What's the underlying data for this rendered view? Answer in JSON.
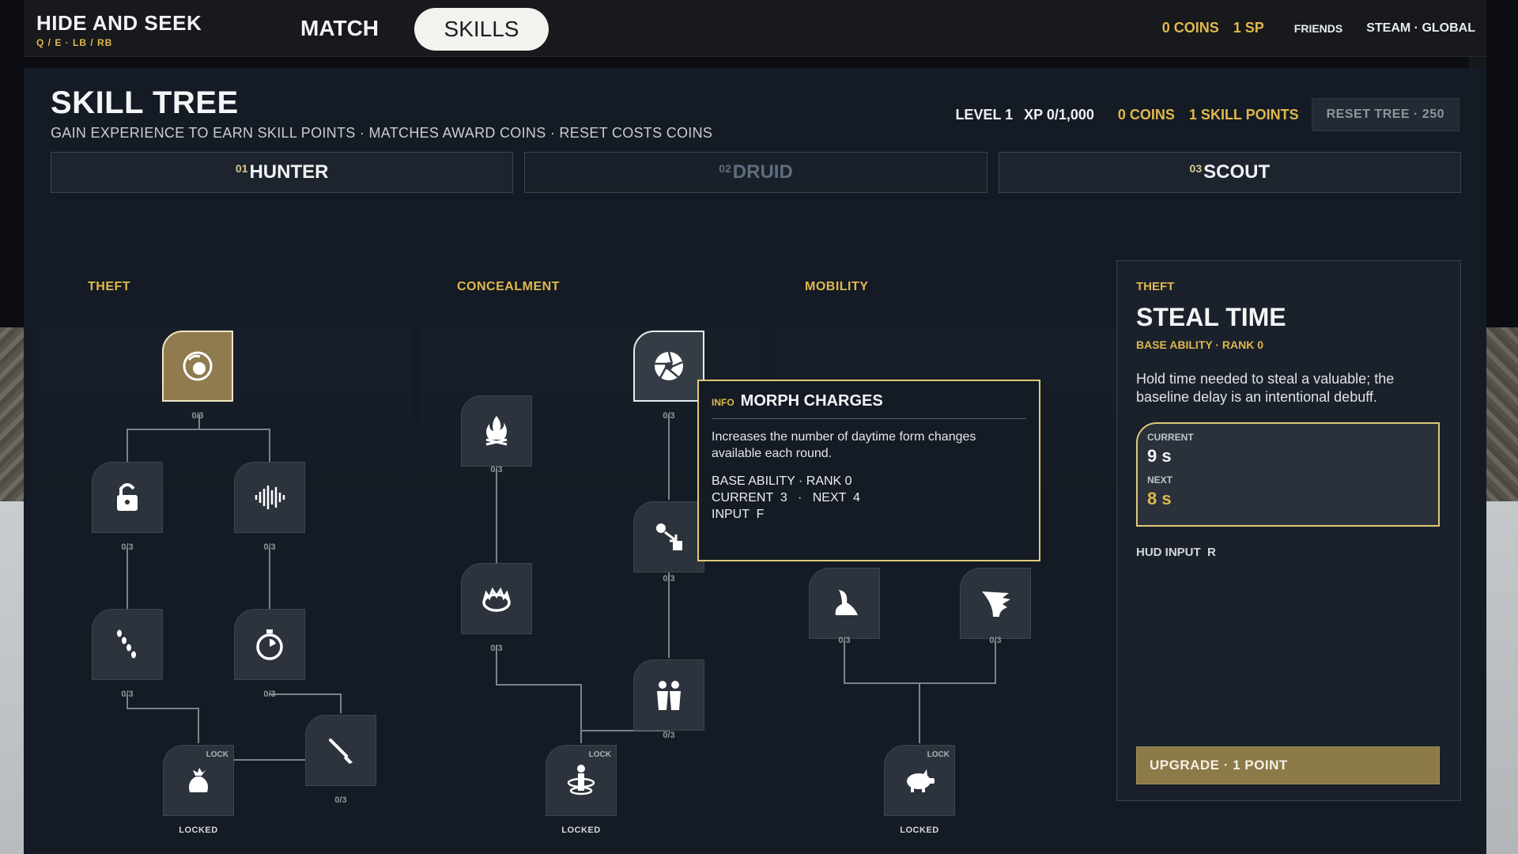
{
  "topbar": {
    "title": "HIDE AND SEEK",
    "subtitle": "Q / E · LB / RB",
    "nav_match": "MATCH",
    "nav_skills": "SKILLS",
    "coins": "0 COINS",
    "sp": "1 SP",
    "friends": "FRIENDS",
    "platform": "STEAM · GLOBAL"
  },
  "header": {
    "title": "SKILL TREE",
    "subtitle": "GAIN EXPERIENCE TO EARN SKILL POINTS · MATCHES AWARD COINS · RESET COSTS COINS",
    "level": "LEVEL 1",
    "xp": "XP 0/1,000",
    "coins": "0 COINS",
    "skill_points": "1 SKILL POINTS",
    "reset": "RESET TREE · 250"
  },
  "tabs": [
    {
      "num": "01",
      "label": "HUNTER"
    },
    {
      "num": "02",
      "label": "DRUID"
    },
    {
      "num": "03",
      "label": "SCOUT"
    }
  ],
  "columns": {
    "theft": "THEFT",
    "concealment": "CONCEALMENT",
    "mobility": "MOBILITY"
  },
  "nodes": {
    "steal_time": {
      "rank": "0/3",
      "icon": "grab-orb-icon"
    },
    "lockpick": {
      "rank": "0/3",
      "icon": "padlock-icon"
    },
    "noise": {
      "rank": "0/3",
      "icon": "soundwave-icon"
    },
    "footsteps": {
      "rank": "0/3",
      "icon": "footsteps-icon"
    },
    "stopwatch": {
      "rank": "0/3",
      "icon": "stopwatch-icon"
    },
    "brush": {
      "rank": "0/3",
      "icon": "brush-icon"
    },
    "loot_bag": {
      "locked": "LOCKED",
      "lock": "LOCK",
      "icon": "loot-bag-icon"
    },
    "campfire": {
      "rank": "0/3",
      "icon": "campfire-icon"
    },
    "fire_ring": {
      "rank": "0/3",
      "icon": "fire-ring-icon"
    },
    "morph_charges": {
      "rank": "0/3",
      "icon": "aperture-icon"
    },
    "swap": {
      "rank": "0/3",
      "icon": "swap-icon"
    },
    "decoy": {
      "rank": "0/3",
      "icon": "decoy-icon"
    },
    "spin": {
      "locked": "LOCKED",
      "lock": "LOCK",
      "icon": "spin-icon"
    },
    "dash": {
      "rank": "0/3",
      "icon": "dash-icon"
    },
    "wing": {
      "rank": "0/3",
      "icon": "wing-icon"
    },
    "pig": {
      "locked": "LOCKED",
      "lock": "LOCK",
      "icon": "pig-icon"
    }
  },
  "tooltip": {
    "tag": "INFO",
    "title": "MORPH CHARGES",
    "desc": "Increases the number of daytime form changes available each round.",
    "line1": "BASE ABILITY · RANK 0",
    "line2": "CURRENT  3   ·   NEXT  4",
    "line3": "INPUT  F"
  },
  "detail": {
    "group": "THEFT",
    "name": "STEAL TIME",
    "meta": "BASE ABILITY · RANK 0",
    "desc": "Hold time needed to steal a valuable; the baseline delay is an intentional debuff.",
    "current_label": "CURRENT",
    "current_value": "9 s",
    "next_label": "NEXT",
    "next_value": "8 s",
    "hud": "HUD INPUT  R",
    "upgrade": "UPGRADE · 1 POINT"
  },
  "colors": {
    "accent": "#e0b84c",
    "panel": "#151b24",
    "node": "#2c333c",
    "active_node": "#8f7b4d"
  }
}
